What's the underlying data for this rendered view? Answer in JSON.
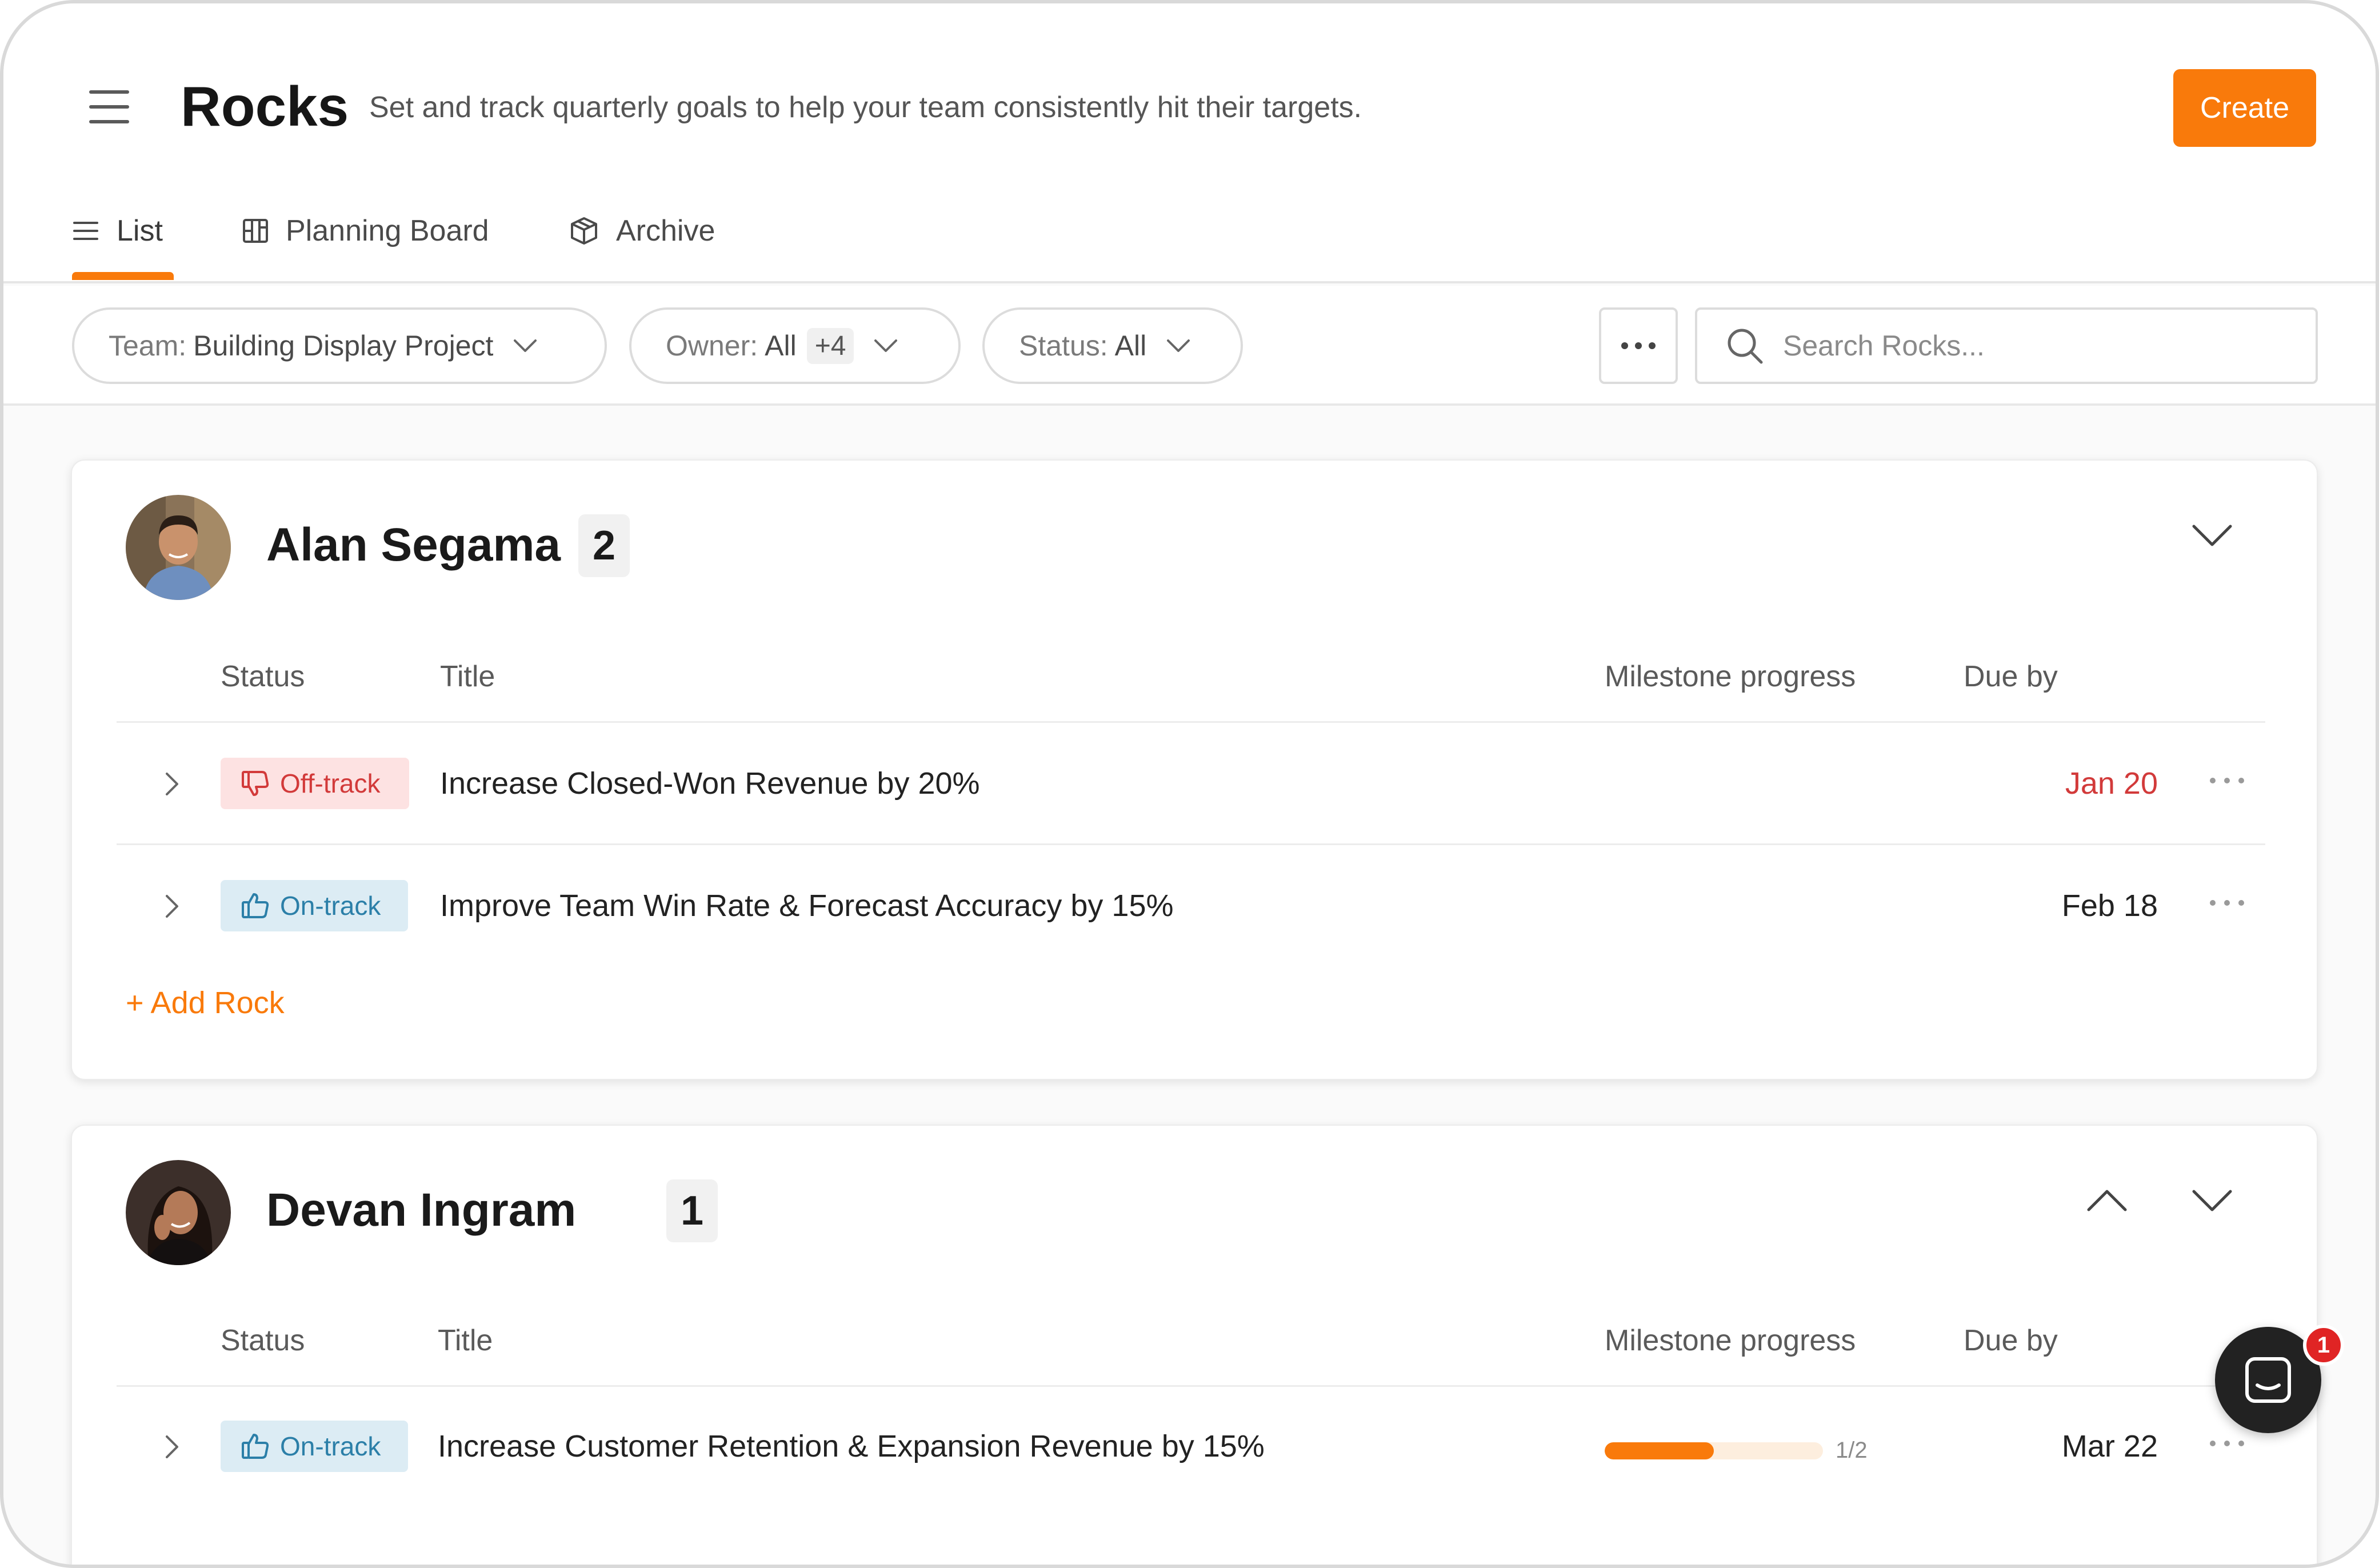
{
  "header": {
    "title": "Rocks",
    "subtitle": "Set and track quarterly goals to help your team consistently hit their targets.",
    "create_label": "Create"
  },
  "tabs": [
    {
      "label": "List",
      "icon": "list-icon",
      "active": true
    },
    {
      "label": "Planning Board",
      "icon": "board-icon",
      "active": false
    },
    {
      "label": "Archive",
      "icon": "archive-box-icon",
      "active": false
    }
  ],
  "filters": {
    "team": {
      "prefix": "Team:",
      "value": "Building Display Project"
    },
    "owner": {
      "prefix": "Owner:",
      "value": "All",
      "extra": "+4"
    },
    "status": {
      "prefix": "Status:",
      "value": "All"
    },
    "search_placeholder": "Search Rocks..."
  },
  "columns": {
    "status": "Status",
    "title": "Title",
    "progress": "Milestone progress",
    "due": "Due by"
  },
  "groups": [
    {
      "owner": "Alan Segama",
      "count": "2",
      "rocks": [
        {
          "status": "Off-track",
          "title": "Increase Closed-Won Revenue by 20%",
          "due": "Jan 20",
          "late": true
        },
        {
          "status": "On-track",
          "title": "Improve Team Win Rate & Forecast Accuracy by 15%",
          "due": "Feb 18",
          "late": false
        }
      ],
      "add_label": "+ Add Rock"
    },
    {
      "owner": "Devan Ingram",
      "count": "1",
      "rocks": [
        {
          "status": "On-track",
          "title": "Increase Customer Retention & Expansion Revenue by 15%",
          "due": "Mar 22",
          "late": false,
          "progress": 0.5,
          "progress_label": "1/2"
        }
      ]
    }
  ],
  "chat": {
    "badge": "1"
  },
  "colors": {
    "accent": "#f97a0b",
    "off_track": "#d23a3a",
    "on_track": "#2b7fa8"
  }
}
